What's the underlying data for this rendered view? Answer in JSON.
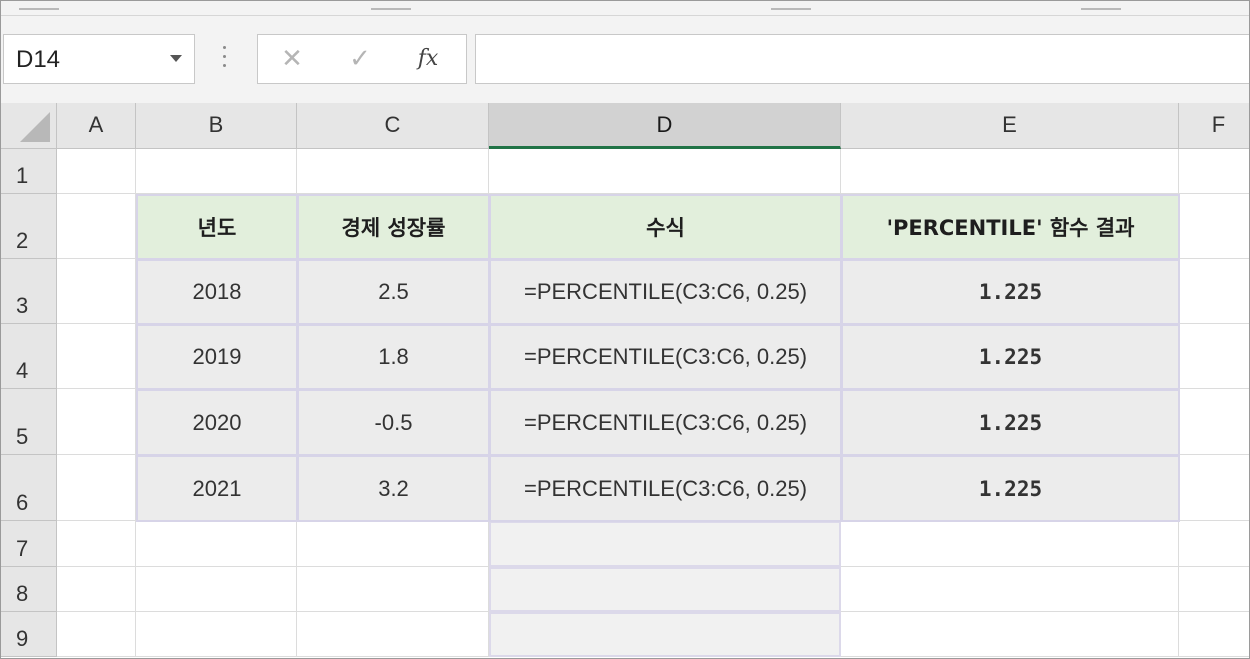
{
  "name_box": {
    "value": "D14"
  },
  "formula_bar": {
    "cancel_icon": "x-icon",
    "enter_icon": "check-icon",
    "fx_label": "fx",
    "content": ""
  },
  "columns": [
    "A",
    "B",
    "C",
    "D",
    "E",
    "F"
  ],
  "rows": [
    "1",
    "2",
    "3",
    "4",
    "5",
    "6",
    "7",
    "8",
    "9"
  ],
  "selected_column": "D",
  "table": {
    "headers": [
      "년도",
      "경제 성장률",
      "수식",
      "'PERCENTILE' 함수 결과"
    ],
    "rows": [
      [
        "2018",
        "2.5",
        "=PERCENTILE(C3:C6, 0.25)",
        "1.225"
      ],
      [
        "2019",
        "1.8",
        "=PERCENTILE(C3:C6, 0.25)",
        "1.225"
      ],
      [
        "2020",
        "-0.5",
        "=PERCENTILE(C3:C6, 0.25)",
        "1.225"
      ],
      [
        "2021",
        "3.2",
        "=PERCENTILE(C3:C6, 0.25)",
        "1.225"
      ]
    ]
  },
  "colors": {
    "header_fill": "#e2efdc",
    "data_fill": "#ececec",
    "selection_accent": "#217346"
  }
}
